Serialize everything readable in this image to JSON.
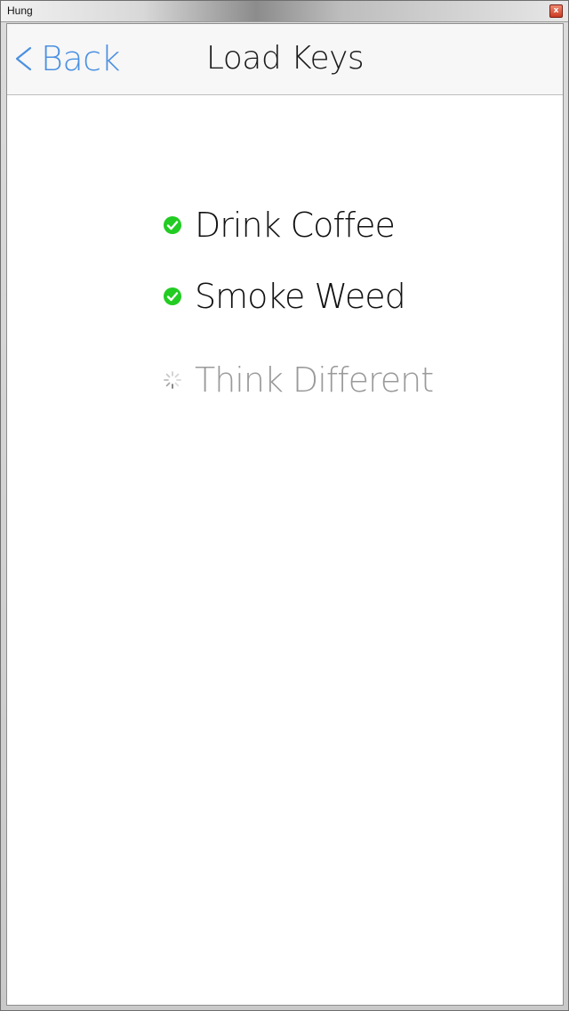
{
  "window": {
    "title": "Hung",
    "close_symbol": "x"
  },
  "navbar": {
    "back_label": "Back",
    "back_icon": "chevron-left-icon",
    "title": "Load Keys"
  },
  "keys": [
    {
      "label": "Drink Coffee",
      "status": "done",
      "icon": "check-circle-icon"
    },
    {
      "label": "Smoke Weed",
      "status": "done",
      "icon": "check-circle-icon"
    },
    {
      "label": "Think Different",
      "status": "loading",
      "icon": "spinner-icon"
    }
  ],
  "colors": {
    "accent": "#4a90e2",
    "success": "#22cc22",
    "pending_text": "#9a9a9a",
    "title_text": "#1a1a1a"
  }
}
